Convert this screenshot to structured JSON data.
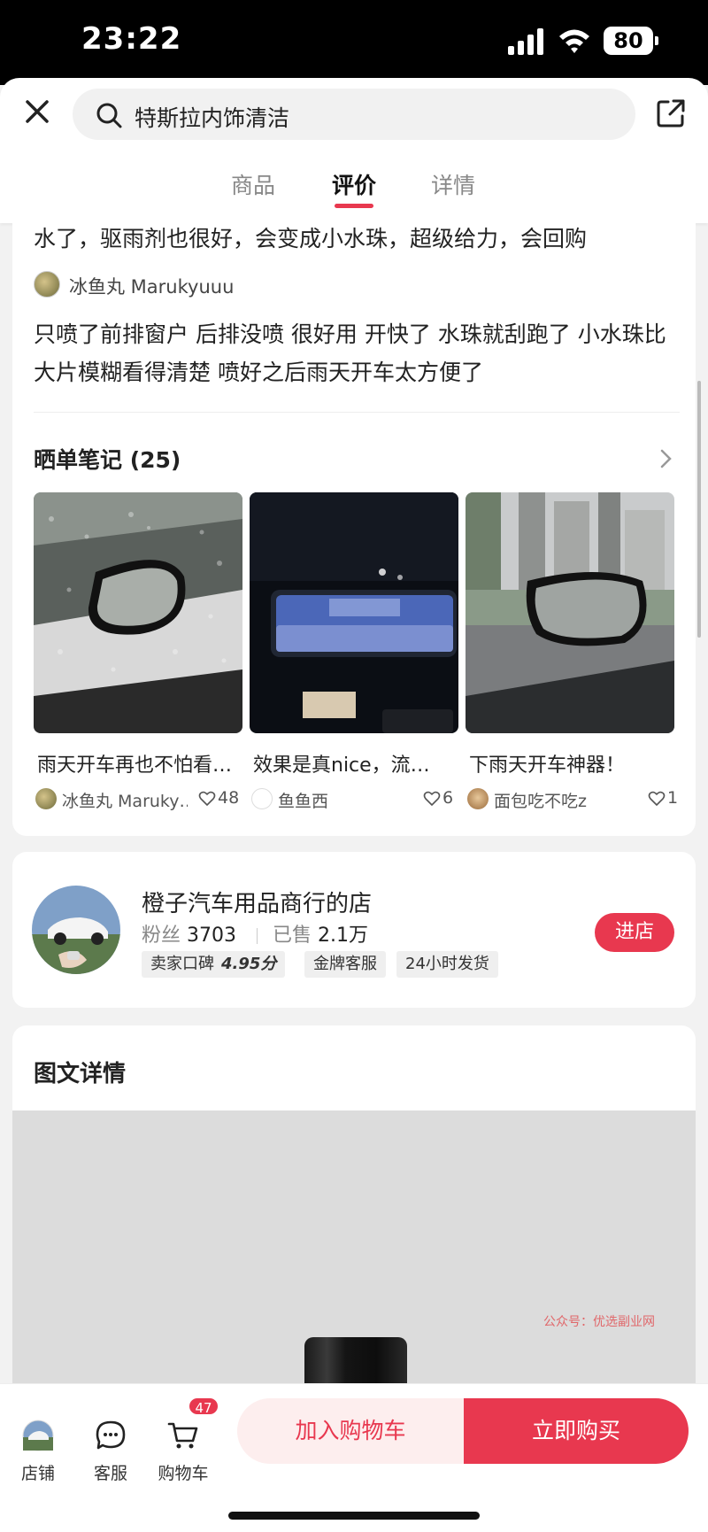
{
  "status_bar": {
    "time": "23:22",
    "battery": "80"
  },
  "header": {
    "search_text": "特斯拉内饰清洁",
    "tabs": [
      {
        "label": "商品",
        "active": false
      },
      {
        "label": "评价",
        "active": true
      },
      {
        "label": "详情",
        "active": false
      }
    ]
  },
  "reviews": {
    "prev_review_tail": "水了，驱雨剂也很好，会变成小水珠，超级给力，会回购",
    "reviewer_name": "冰鱼丸 Marukyuuu",
    "review_text": "只喷了前排窗户 后排没喷 很好用 开快了 水珠就刮跑了 小水珠比大片模糊看得清楚 喷好之后雨天开车太方便了"
  },
  "notes": {
    "title": "晒单笔记 (25)",
    "items": [
      {
        "title": "雨天开车再也不怕看…",
        "author": "冰鱼丸 Maruky…",
        "likes": "48"
      },
      {
        "title": "效果是真nice，流…",
        "author": "鱼鱼西",
        "likes": "6"
      },
      {
        "title": "下雨天开车神器！",
        "author": "面包吃不吃z",
        "likes": "1"
      }
    ]
  },
  "shop": {
    "name": "橙子汽车用品商行的店",
    "fans_label": "粉丝",
    "fans_value": "3703",
    "sold_label": "已售",
    "sold_value": "2.1万",
    "tag_rating_label": "卖家口碑",
    "tag_rating_value": "4.95分",
    "tag_service": "金牌客服",
    "tag_shipping": "24小时发货",
    "enter_label": "进店"
  },
  "details": {
    "title": "图文详情",
    "watermark": "公众号：优选副业网"
  },
  "bottom_bar": {
    "store_label": "店铺",
    "service_label": "客服",
    "cart_label": "购物车",
    "cart_count": "47",
    "add_to_cart": "加入购物车",
    "buy_now": "立即购买"
  },
  "colors": {
    "accent": "#e8384f",
    "accent_light": "#fdeeee"
  }
}
